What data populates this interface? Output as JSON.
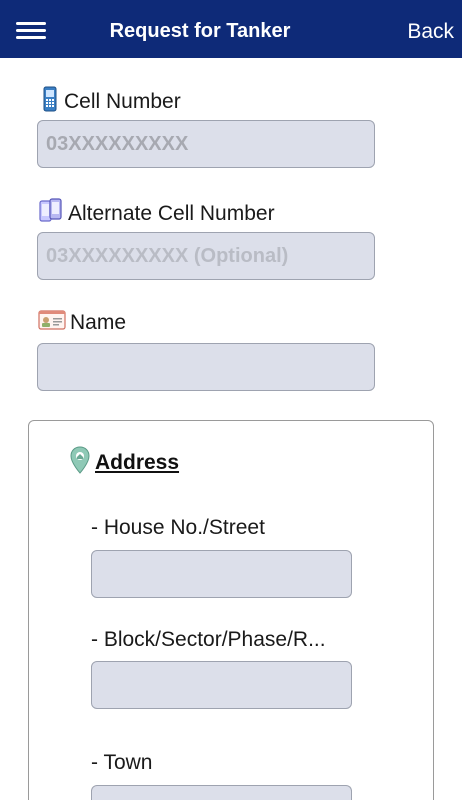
{
  "header": {
    "title": "Request for Tanker",
    "back_label": "Back"
  },
  "form": {
    "cell_number": {
      "label": "Cell Number",
      "placeholder": "03XXXXXXXXX",
      "icon": "mobile-phone-icon"
    },
    "alt_cell_number": {
      "label": "Alternate Cell Number",
      "placeholder": "03XXXXXXXXX (Optional)",
      "icon": "two-phones-icon"
    },
    "name": {
      "label": "Name",
      "placeholder": "",
      "icon": "id-card-icon"
    }
  },
  "address": {
    "heading": "Address",
    "icon": "map-pin-icon",
    "house": {
      "label": "- House No./Street",
      "placeholder": ""
    },
    "block": {
      "label": "- Block/Sector/Phase/R...",
      "placeholder": ""
    },
    "town": {
      "label": "- Town",
      "placeholder": ""
    }
  },
  "colors": {
    "header_bg": "#0e2a78",
    "input_bg": "#dcdfea",
    "input_border": "#9ea3b0"
  }
}
